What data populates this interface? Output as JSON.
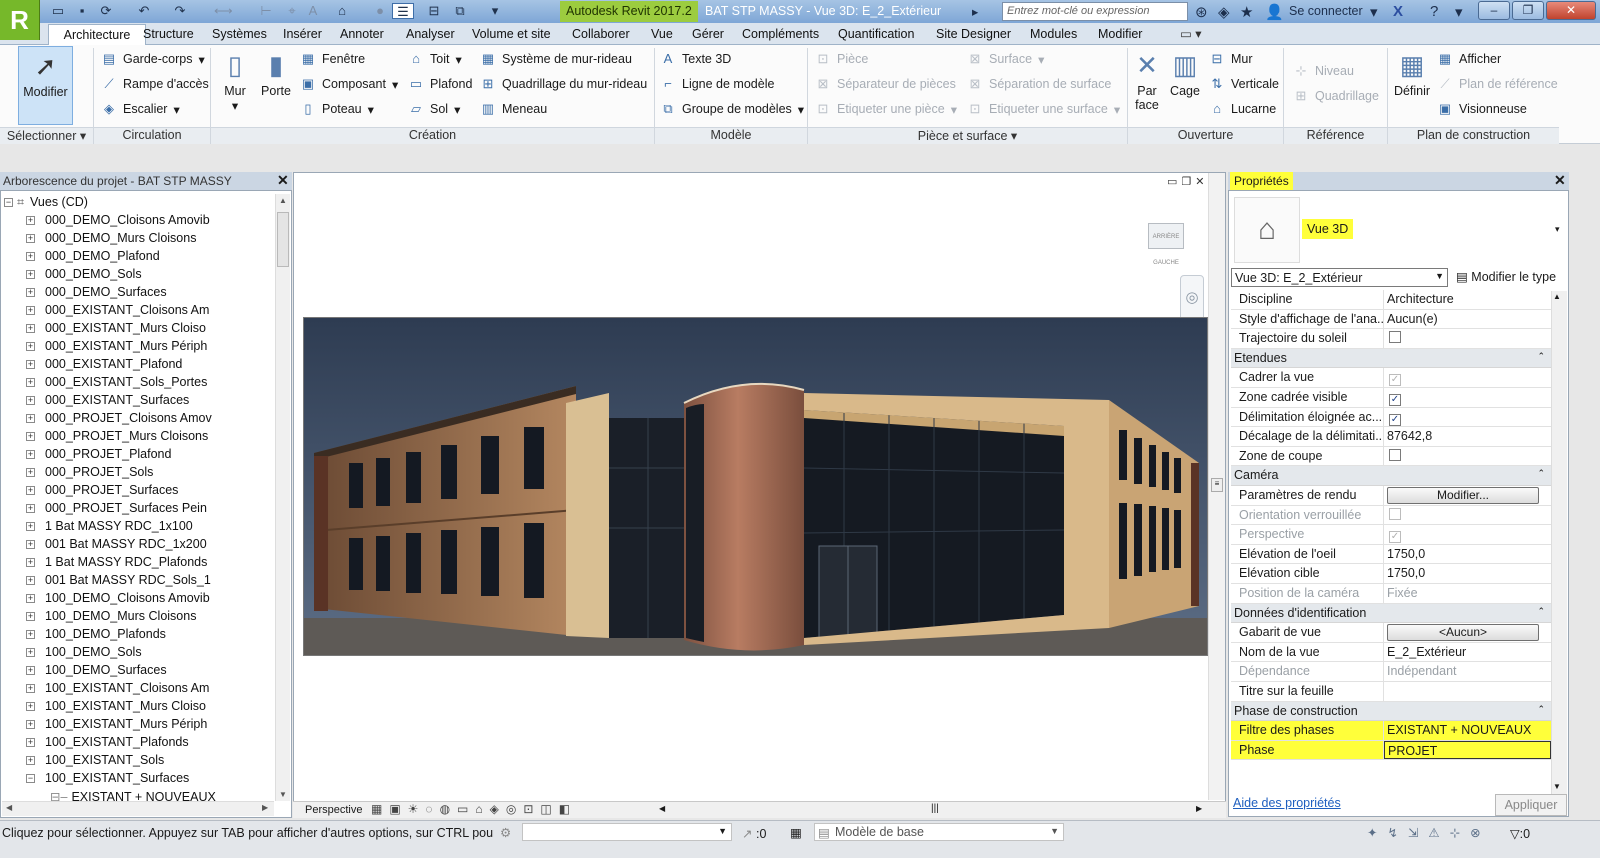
{
  "window": {
    "app_title": "Autodesk Revit 2017.2",
    "document_title": "BAT STP MASSY - Vue 3D: E_2_Extérieur",
    "search_placeholder": "Entrez mot-clé ou expression",
    "sign_in": "Se connecter",
    "logo": "R"
  },
  "ribbon_tabs": [
    "Architecture",
    "Structure",
    "Systèmes",
    "Insérer",
    "Annoter",
    "Analyser",
    "Volume et site",
    "Collaborer",
    "Vue",
    "Gérer",
    "Compléments",
    "Quantification",
    "Site Designer",
    "Modules",
    "Modifier"
  ],
  "ribbon": {
    "select": {
      "modify": "Modifier",
      "panel": "Sélectionner ▾"
    },
    "circulation": {
      "items": [
        "Garde-corps",
        "Rampe d'accès",
        "Escalier"
      ],
      "panel": "Circulation"
    },
    "creation": {
      "wall": "Mur",
      "door": "Porte",
      "col1": [
        "Fenêtre",
        "Composant",
        "Poteau"
      ],
      "col2": [
        "Toit",
        "Plafond",
        "Sol"
      ],
      "col3": [
        "Système de mur-rideau",
        "Quadrillage du mur-rideau",
        "Meneau"
      ],
      "panel": "Création"
    },
    "model": {
      "items": [
        "Texte 3D",
        "Ligne de modèle",
        "Groupe de modèles"
      ],
      "panel": "Modèle"
    },
    "room": {
      "col1": [
        "Pièce",
        "Séparateur de pièces",
        "Etiqueter une pièce"
      ],
      "col2": [
        "Surface",
        "Séparation de surface",
        "Etiqueter une surface"
      ],
      "panel": "Pièce et surface ▾"
    },
    "opening": {
      "by_face": "Par face",
      "shaft": "Cage",
      "items": [
        "Mur",
        "Verticale",
        "Lucarne"
      ],
      "panel": "Ouverture"
    },
    "datum": {
      "items": [
        "Niveau",
        "Quadrillage"
      ],
      "panel": "Référence"
    },
    "workplane": {
      "set": "Définir",
      "items": [
        "Afficher",
        "Plan de référence",
        "Visionneuse"
      ],
      "panel": "Plan de construction"
    }
  },
  "project_browser": {
    "title": "Arborescence du projet - BAT STP MASSY",
    "root": "Vues (CD)",
    "items": [
      "000_DEMO_Cloisons Amovib",
      "000_DEMO_Murs Cloisons",
      "000_DEMO_Plafond",
      "000_DEMO_Sols",
      "000_DEMO_Surfaces",
      "000_EXISTANT_Cloisons Am",
      "000_EXISTANT_Murs Cloiso",
      "000_EXISTANT_Murs Périph",
      "000_EXISTANT_Plafond",
      "000_EXISTANT_Sols_Portes",
      "000_EXISTANT_Surfaces",
      "000_PROJET_Cloisons Amov",
      "000_PROJET_Murs Cloisons",
      "000_PROJET_Plafond",
      "000_PROJET_Sols",
      "000_PROJET_Surfaces",
      "000_PROJET_Surfaces Pein",
      "1 Bat MASSY RDC_1x100",
      "001 Bat MASSY RDC_1x200",
      "1 Bat MASSY RDC_Plafonds",
      "001 Bat MASSY RDC_Sols_1",
      "100_DEMO_Cloisons Amovib",
      "100_DEMO_Murs Cloisons",
      "100_DEMO_Plafonds",
      "100_DEMO_Sols",
      "100_DEMO_Surfaces",
      "100_EXISTANT_Cloisons Am",
      "100_EXISTANT_Murs Cloiso",
      "100_EXISTANT_Murs Périph",
      "100_EXISTANT_Plafonds",
      "100_EXISTANT_Sols",
      "100_EXISTANT_Surfaces"
    ],
    "sub_item": "EXISTANT + NOUVEAUX"
  },
  "view": {
    "mode": "Perspective",
    "viewcube_label": "ARRIÈRE GAUCHE"
  },
  "properties": {
    "title": "Propriétés",
    "type_name": "Vue 3D",
    "selector": "Vue 3D: E_2_Extérieur",
    "edit_type": "Modifier le type",
    "rows_top": [
      {
        "label": "Discipline",
        "value": "Architecture"
      },
      {
        "label": "Style d'affichage de l'ana...",
        "value": "Aucun(e)"
      },
      {
        "label": "Trajectoire du soleil",
        "check": "off"
      }
    ],
    "group_extents": "Etendues",
    "rows_extents": [
      {
        "label": "Cadrer la vue",
        "check": "dis-on"
      },
      {
        "label": "Zone cadrée visible",
        "check": "on"
      },
      {
        "label": "Délimitation éloignée ac...",
        "check": "on"
      },
      {
        "label": "Décalage de la délimitati...",
        "value": "87642,8"
      },
      {
        "label": "Zone de coupe",
        "check": "off"
      }
    ],
    "group_camera": "Caméra",
    "rows_camera": [
      {
        "label": "Paramètres de rendu",
        "button": "Modifier..."
      },
      {
        "label": "Orientation verrouillée",
        "check": "dis-off",
        "disabled": true
      },
      {
        "label": "Perspective",
        "check": "dis-on",
        "disabled": true
      },
      {
        "label": "Elévation de l'oeil",
        "value": "1750,0"
      },
      {
        "label": "Elévation cible",
        "value": "1750,0"
      },
      {
        "label": "Position de la caméra",
        "value": "Fixée",
        "disabled": true
      }
    ],
    "group_identity": "Données d'identification",
    "rows_identity": [
      {
        "label": "Gabarit de vue",
        "button": "<Aucun>"
      },
      {
        "label": "Nom de la vue",
        "value": "E_2_Extérieur"
      },
      {
        "label": "Dépendance",
        "value": "Indépendant",
        "disabled": true
      },
      {
        "label": "Titre sur la feuille",
        "value": ""
      }
    ],
    "group_phasing": "Phase de construction",
    "rows_phasing": [
      {
        "label": "Filtre des phases",
        "value": "EXISTANT + NOUVEAUX"
      },
      {
        "label": "Phase",
        "value": "PROJET"
      }
    ],
    "help": "Aide des propriétés",
    "apply": "Appliquer"
  },
  "status": {
    "message": "Cliquez pour sélectionner. Appuyez sur TAB pour afficher d'autres options, sur CTRL pour ajo",
    "selection_count": ":0",
    "model": "Modèle de base",
    "filter_count": ":0"
  },
  "colors": {
    "highlight": "#ffff3a",
    "logo_green": "#76b82a",
    "title_blue": "#8fb3dd"
  }
}
